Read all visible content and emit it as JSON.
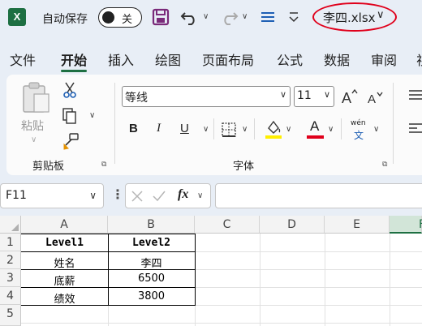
{
  "titlebar": {
    "app_icon_letter": "X",
    "autosave_label": "自动保存",
    "autosave_state": "关",
    "filename": "李四.xlsx",
    "filename_chevron": "∨"
  },
  "tabs": [
    {
      "label": "文件"
    },
    {
      "label": "开始"
    },
    {
      "label": "插入"
    },
    {
      "label": "绘图"
    },
    {
      "label": "页面布局"
    },
    {
      "label": "公式"
    },
    {
      "label": "数据"
    },
    {
      "label": "审阅"
    },
    {
      "label": "视"
    }
  ],
  "ribbon": {
    "paste_label": "粘贴",
    "clipboard_label": "剪贴板",
    "font_group_label": "字体",
    "font_name": "等线",
    "font_size": "11",
    "bold": "B",
    "italic": "I",
    "underline": "U",
    "font_color_letter": "A",
    "phonetic_top": "wén",
    "phonetic_bottom": "文",
    "grow_font": "A^",
    "shrink_font": "A˅",
    "font_color_hex": "#e0001b",
    "fill_color_hex": "#ffef00"
  },
  "formula_bar": {
    "name_box": "F11",
    "fx_label": "fx",
    "formula_value": ""
  },
  "sheet": {
    "columns": [
      "A",
      "B",
      "C",
      "D",
      "E",
      "F"
    ],
    "rows": [
      "1",
      "2",
      "3",
      "4",
      "5"
    ],
    "cells": {
      "A1": "Level1",
      "B1": "Level2",
      "A2": "姓名",
      "B2": "李四",
      "A3": "底薪",
      "B3": "6500",
      "A4": "绩效",
      "B4": "3800"
    }
  }
}
